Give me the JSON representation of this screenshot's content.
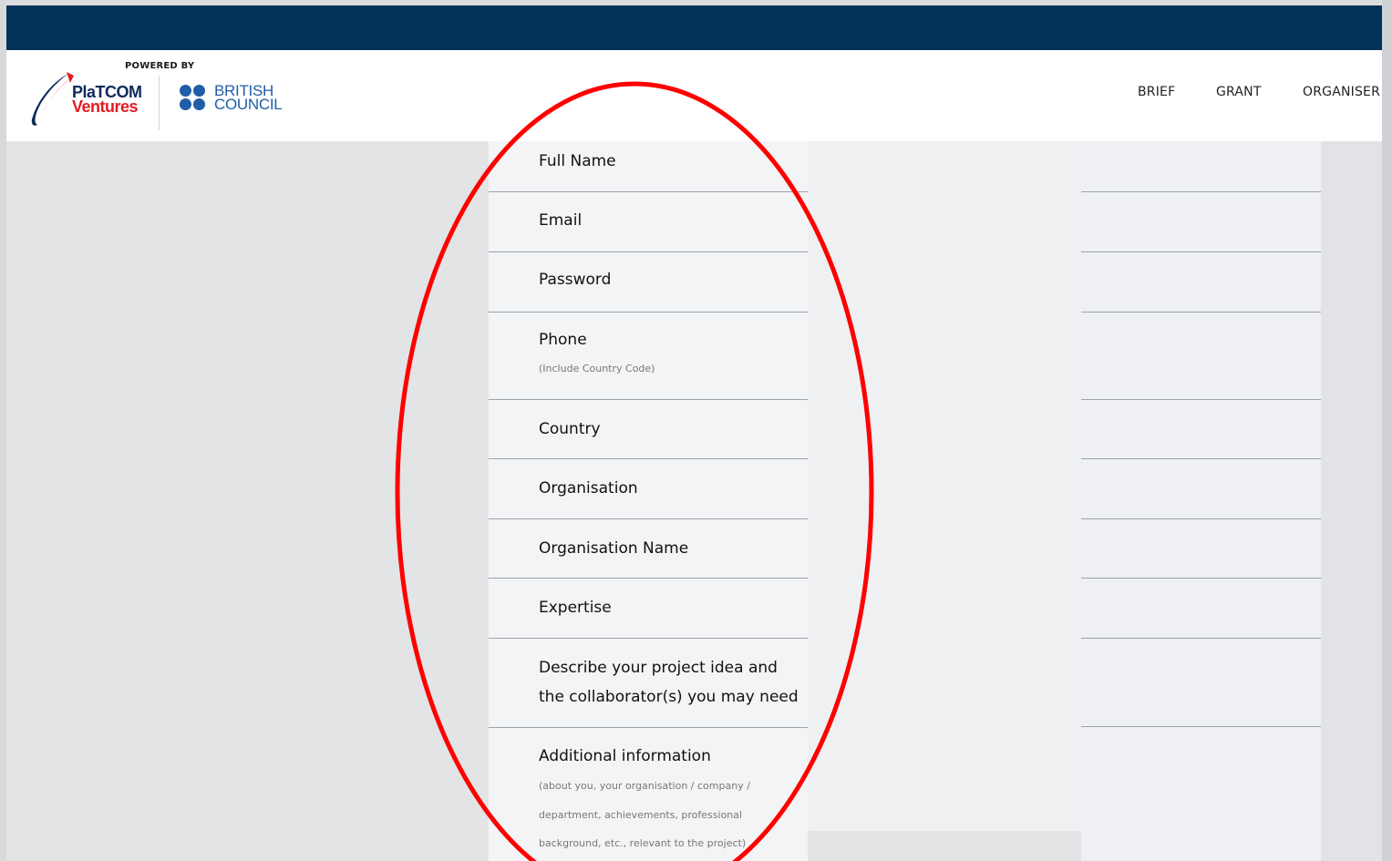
{
  "header": {
    "powered_by": "POWERED BY",
    "brand_line1": "PlaTCOM",
    "brand_line2": "Ventures",
    "partner_line1": "BRITISH",
    "partner_line2": "COUNCIL"
  },
  "nav": {
    "items": [
      "BRIEF",
      "GRANT",
      "ORGANISER"
    ]
  },
  "form": {
    "full_name": "Full Name",
    "email": "Email",
    "password": "Password",
    "phone": "Phone",
    "phone_hint": "(Include Country Code)",
    "country": "Country",
    "organisation": "Organisation",
    "organisation_name": "Organisation Name",
    "expertise": "Expertise",
    "project_line1": "Describe your project idea and",
    "project_line2": "the collaborator(s) you may need",
    "additional": "Additional information",
    "additional_hint1": "(about you, your organisation / company /",
    "additional_hint2": "department, achievements, professional",
    "additional_hint3": "background, etc., relevant to the project)"
  },
  "colors": {
    "topbar": "#00325a",
    "annotation": "#ff0000",
    "brand_red": "#e31b23",
    "brand_navy": "#0e2a5a",
    "british_council_blue": "#1f5ea8"
  }
}
